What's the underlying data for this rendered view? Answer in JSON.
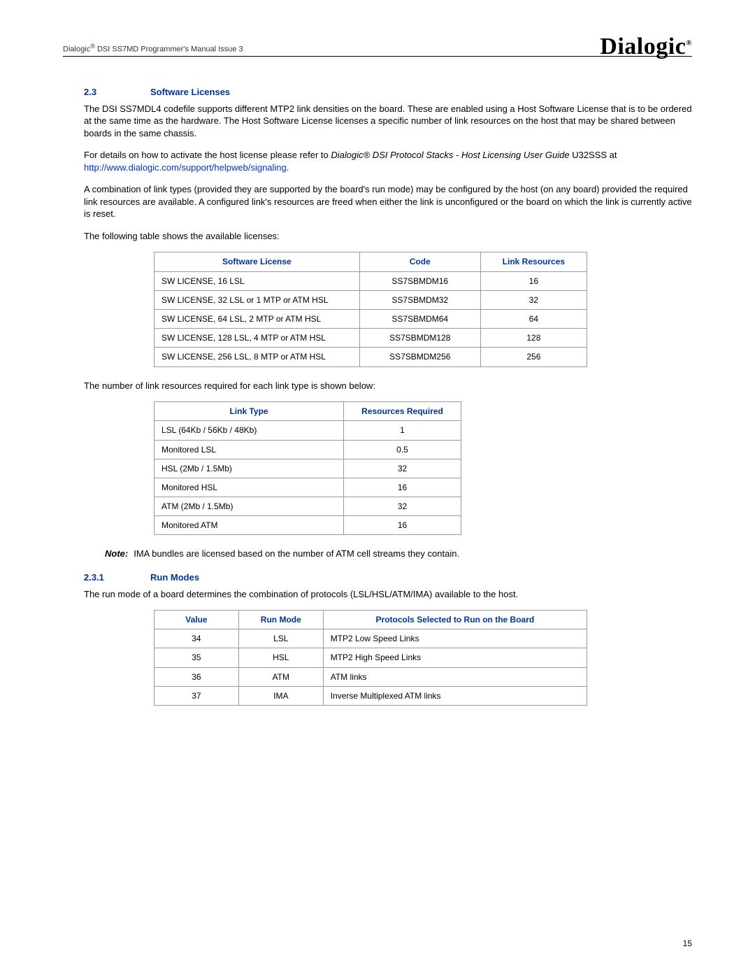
{
  "header": {
    "doc_title_prefix": "Dialogic",
    "doc_title_suffix": " DSI SS7MD Programmer's Manual  Issue 3",
    "logo_text": "Dialogic",
    "logo_reg": "®"
  },
  "section_23": {
    "number": "2.3",
    "title": "Software Licenses",
    "para1": "The DSI SS7MDL4 codefile supports different MTP2 link densities on the board. These are enabled using a Host Software License that is to be ordered at the same time as the hardware. The Host Software License licenses a specific number of link resources on the host that may be shared between boards in the same chassis.",
    "para2_pre": "For details on how to activate the host license please refer to ",
    "para2_em": "Dialogic® DSI Protocol Stacks - Host Licensing User Guide",
    "para2_mid": " U32SSS at ",
    "para2_link": "http://www.dialogic.com/support/helpweb/signaling",
    "para2_post": ".",
    "para3": "A combination of link types (provided they are supported by the board's run mode) may be configured by the host (on any board) provided the required link resources are available. A configured link's resources are freed when either the link is unconfigured or the board on which the link is currently active is reset.",
    "para4": "The following table shows the available licenses:"
  },
  "table_licenses": {
    "headers": [
      "Software License",
      "Code",
      "Link Resources"
    ],
    "rows": [
      {
        "license": "SW LICENSE, 16 LSL",
        "code": "SS7SBMDM16",
        "resources": "16"
      },
      {
        "license": "SW LICENSE, 32 LSL or 1 MTP or ATM HSL",
        "code": "SS7SBMDM32",
        "resources": "32"
      },
      {
        "license": "SW LICENSE, 64 LSL, 2 MTP or ATM HSL",
        "code": "SS7SBMDM64",
        "resources": "64"
      },
      {
        "license": "SW LICENSE, 128 LSL, 4 MTP or ATM HSL",
        "code": "SS7SBMDM128",
        "resources": "128"
      },
      {
        "license": "SW LICENSE, 256 LSL, 8 MTP or ATM HSL",
        "code": "SS7SBMDM256",
        "resources": "256"
      }
    ]
  },
  "para_between_tables": "The number of link resources required for each link type is shown below:",
  "table_linktypes": {
    "headers": [
      "Link Type",
      "Resources Required"
    ],
    "rows": [
      {
        "type": "LSL (64Kb / 56Kb / 48Kb)",
        "req": "1"
      },
      {
        "type": "Monitored LSL",
        "req": "0.5"
      },
      {
        "type": "HSL (2Mb / 1.5Mb)",
        "req": "32"
      },
      {
        "type": "Monitored HSL",
        "req": "16"
      },
      {
        "type": "ATM (2Mb / 1.5Mb)",
        "req": "32"
      },
      {
        "type": "Monitored ATM",
        "req": "16"
      }
    ]
  },
  "note": {
    "label": "Note:",
    "text": "IMA bundles are licensed based on the number of ATM cell streams they contain."
  },
  "section_231": {
    "number": "2.3.1",
    "title": "Run Modes",
    "para1": "The run mode of a board determines the combination of protocols (LSL/HSL/ATM/IMA) available to the host."
  },
  "table_runmodes": {
    "headers": [
      "Value",
      "Run Mode",
      "Protocols Selected to Run on the Board"
    ],
    "rows": [
      {
        "value": "34",
        "mode": "LSL",
        "proto": "MTP2 Low Speed Links"
      },
      {
        "value": "35",
        "mode": "HSL",
        "proto": "MTP2 High Speed Links"
      },
      {
        "value": "36",
        "mode": "ATM",
        "proto": "ATM links"
      },
      {
        "value": "37",
        "mode": "IMA",
        "proto": "Inverse Multiplexed ATM links"
      }
    ]
  },
  "page_number": "15"
}
